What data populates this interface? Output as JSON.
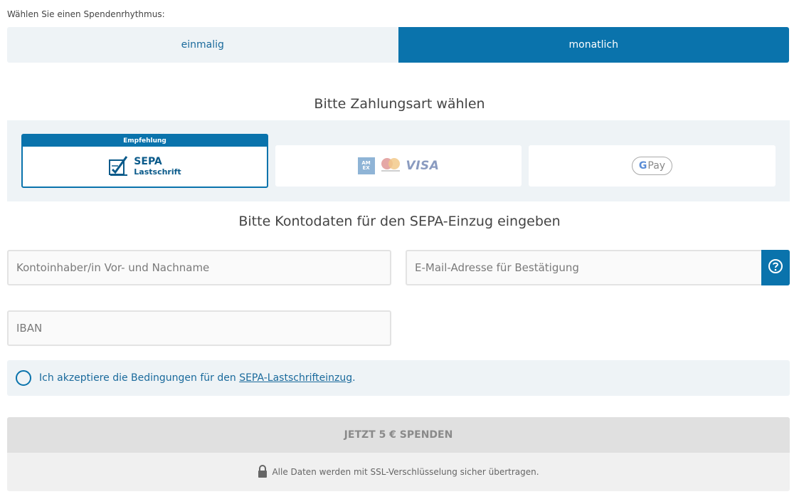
{
  "rhythm": {
    "label": "Wählen Sie einen Spendenrhythmus:",
    "options": [
      {
        "label": "einmalig",
        "selected": false
      },
      {
        "label": "monatlich",
        "selected": true
      }
    ]
  },
  "payment": {
    "heading": "Bitte Zahlungsart wählen",
    "methods": {
      "sepa": {
        "badge": "Empfehlung",
        "title": "SEPA",
        "subtitle": "Lastschrift",
        "selected": true,
        "icon": "sepa-check-icon"
      },
      "cards": {
        "brands": [
          "AMEX",
          "mastercard",
          "VISA"
        ],
        "amex_text": "AM EX",
        "visa_text": "VISA"
      },
      "gpay": {
        "g": "G",
        "text": "Pay"
      }
    }
  },
  "account": {
    "heading": "Bitte Kontodaten für den SEPA-Einzug eingeben",
    "name_placeholder": "Kontoinhaber/in Vor- und Nachname",
    "email_placeholder": "E-Mail-Adresse für Bestätigung",
    "iban_placeholder": "IBAN",
    "help_icon": "question-circle-icon"
  },
  "consent": {
    "text_before": "Ich akzeptiere die Bedingungen für den ",
    "link_text": "SEPA-Lastschrifteinzug",
    "text_after": "."
  },
  "submit": {
    "label": "JETZT 5 € SPENDEN"
  },
  "security": {
    "icon": "lock-icon",
    "text": "Alle Daten werden mit SSL-Verschlüsselung sicher übertragen."
  },
  "colors": {
    "primary": "#0a73ac",
    "panel": "#eef3f6",
    "disabled": "#e0e0e0"
  }
}
